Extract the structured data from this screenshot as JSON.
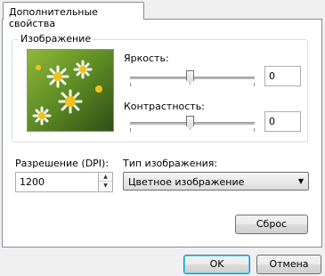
{
  "tab": {
    "label": "Дополнительные свойства"
  },
  "image_group": {
    "title": "Изображение",
    "brightness": {
      "label": "Яркость:",
      "value": "0",
      "level": 0.5
    },
    "contrast": {
      "label": "Контрастность:",
      "value": "0",
      "level": 0.5
    }
  },
  "resolution": {
    "label": "Разрешение (DPI):",
    "value": "1200"
  },
  "image_type": {
    "label": "Тип изображения:",
    "selected": "Цветное изображение"
  },
  "buttons": {
    "reset": "Сброс",
    "ok": "OK",
    "cancel": "Отмена"
  },
  "colors": {
    "panel_bg": "#ffffff",
    "window_bg": "#f0f0f0",
    "default_button_border": "#3c7fb1"
  }
}
